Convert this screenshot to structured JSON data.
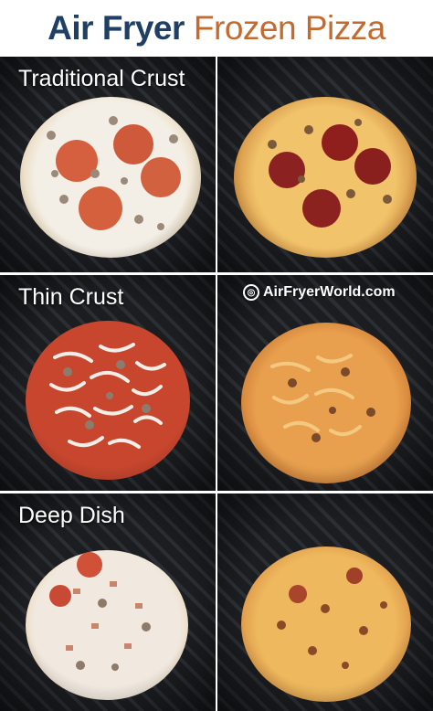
{
  "header": {
    "title_part1": "Air Fryer",
    "title_part2": "Frozen Pizza"
  },
  "panels": {
    "traditional_label": "Traditional Crust",
    "thin_label": "Thin Crust",
    "deep_label": "Deep Dish",
    "watermark": "AirFryerWorld.com"
  },
  "colors": {
    "title_blue": "#1f3f66",
    "title_orange": "#c46a2e",
    "basket": "#202225"
  },
  "icons": {
    "watermark_logo": "air-fryer-world-logo-icon"
  }
}
